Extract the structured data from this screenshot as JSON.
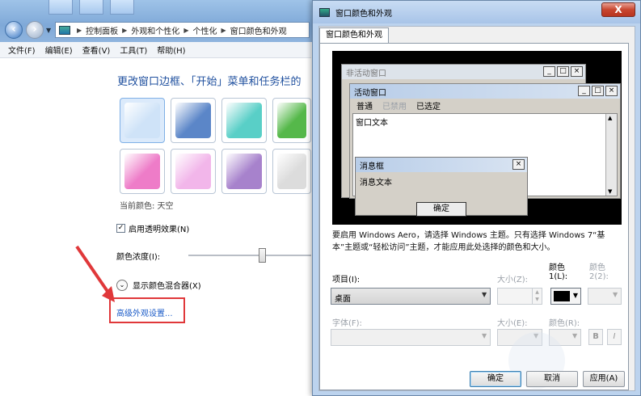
{
  "window_bg": {
    "address": [
      "控制面板",
      "外观和个性化",
      "个性化",
      "窗口颜色和外观"
    ],
    "menu": [
      "文件(F)",
      "编辑(E)",
      "查看(V)",
      "工具(T)",
      "帮助(H)"
    ],
    "heading": "更改窗口边框、「开始」菜单和任务栏的",
    "swatches": [
      "#cfe3f8",
      "#5b86c8",
      "#59cfc7",
      "#55b84a",
      "#ee7cc8",
      "#f2b6ea",
      "#a782cc",
      "#dcdcdc"
    ],
    "current_color_label": "当前颜色: 天空",
    "transparency_label": "启用透明效果(N)",
    "transparency_checked": true,
    "intensity_label": "颜色浓度(I):",
    "intensity_level": 0.6,
    "mixer_label": "显示颜色混合器(X)",
    "advanced_link": "高级外观设置..."
  },
  "dialog": {
    "title": "窗口颜色和外观",
    "close": "X",
    "tab": "窗口颜色和外观",
    "preview": {
      "inactive_title": "非活动窗口",
      "active_title": "活动窗口",
      "menu_normal": "普通",
      "menu_disabled": "已禁用",
      "menu_selected": "已选定",
      "window_text": "窗口文本",
      "msg_title": "消息框",
      "msg_text": "消息文本",
      "ok": "确定",
      "btn_min": "_",
      "btn_max": "□",
      "btn_close": "×"
    },
    "note": "要启用 Windows Aero，请选择 Windows 主题。只有选择 Windows 7“基本”主题或“轻松访问”主题，才能应用此处选择的颜色和大小。",
    "item_label": "项目(I):",
    "item_value": "桌面",
    "size_label": "大小(Z):",
    "color1_label": "颜色",
    "color1_label2": "1(L):",
    "color2_label": "颜色",
    "color2_label2": "2(2):",
    "font_label": "字体(F):",
    "font_size_label": "大小(E):",
    "font_color_label": "颜色(R):",
    "bold": "B",
    "italic": "I",
    "ok_button": "确定",
    "cancel_button": "取消",
    "apply_button": "应用(A)"
  }
}
